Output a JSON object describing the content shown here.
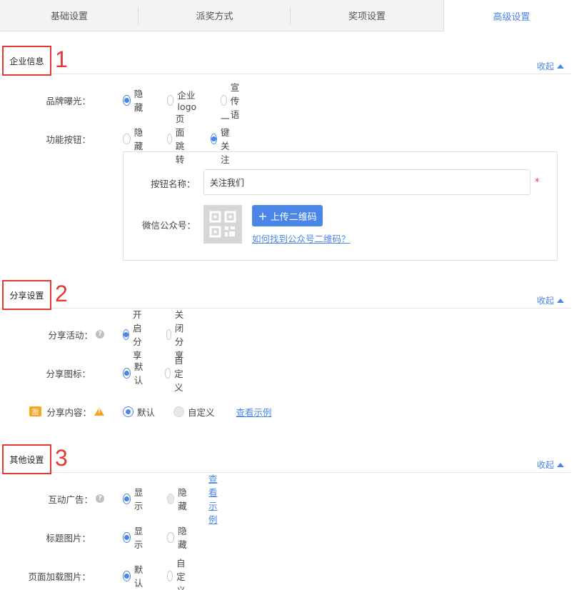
{
  "tabs": [
    {
      "label": "基础设置",
      "active": false
    },
    {
      "label": "派奖方式",
      "active": false
    },
    {
      "label": "奖项设置",
      "active": false
    },
    {
      "label": "高级设置",
      "active": true
    }
  ],
  "collapse_label": "收起",
  "sections": {
    "company": {
      "title": "企业信息",
      "num": "1",
      "brand": {
        "label": "品牌曝光：",
        "options": [
          "隐藏",
          "企业logo",
          "宣传语"
        ],
        "selected": 0
      },
      "func": {
        "label": "功能按钮：",
        "options": [
          "隐藏",
          "页面跳转",
          "一键关注"
        ],
        "selected": 2
      },
      "panel": {
        "btn_name_label": "按钮名称：",
        "btn_name_value": "关注我们",
        "required_mark": "*",
        "wechat_label": "微信公众号：",
        "upload_label": "上传二维码",
        "help_link": "如何找到公众号二维码？"
      }
    },
    "share": {
      "title": "分享设置",
      "num": "2",
      "activity": {
        "label": "分享活动：",
        "options": [
          "开启分享",
          "关闭分享"
        ],
        "selected": 0
      },
      "icon": {
        "label": "分享图标：",
        "options": [
          "默认",
          "自定义"
        ],
        "selected": 0
      },
      "content": {
        "label": "分享内容：",
        "badge": "图",
        "options": [
          "默认",
          "自定义"
        ],
        "selected": 0,
        "example": "查看示例"
      }
    },
    "other": {
      "title": "其他设置",
      "num": "3",
      "ads": {
        "label": "互动广告：",
        "options": [
          "显示",
          "隐藏"
        ],
        "selected": 0,
        "example": "查看示例"
      },
      "title_img": {
        "label": "标题图片：",
        "options": [
          "显示",
          "隐藏"
        ],
        "selected": 0
      },
      "loading_img": {
        "label": "页面加载图片：",
        "options": [
          "默认",
          "自定义"
        ],
        "selected": 0
      }
    }
  },
  "colors": {
    "accent": "#4a86e8",
    "annotation": "#e53935",
    "warning": "#f5a623"
  }
}
